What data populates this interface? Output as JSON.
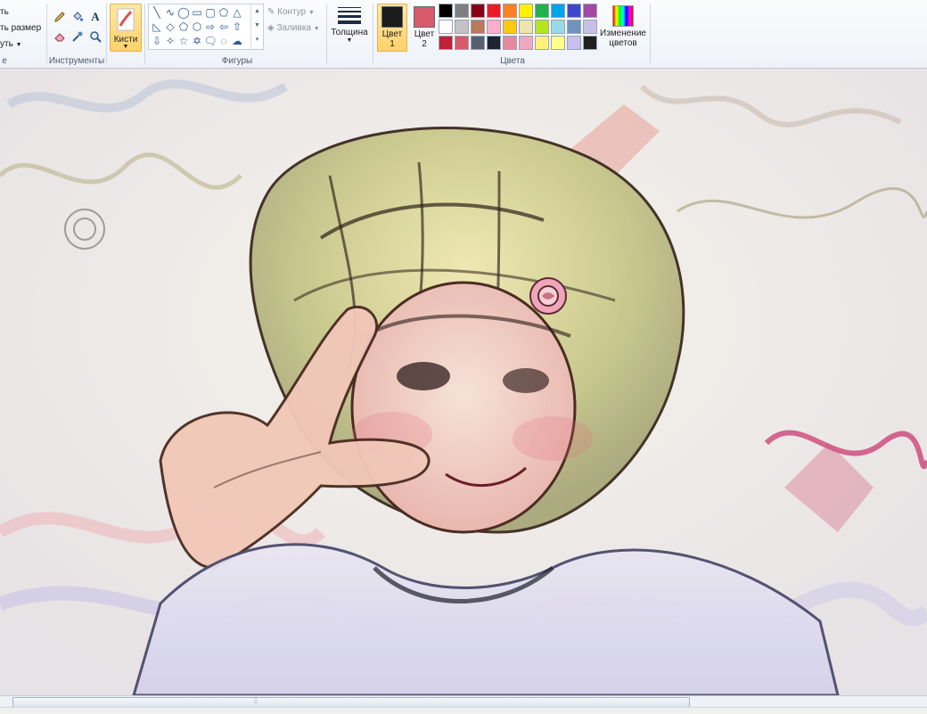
{
  "ribbon": {
    "image_group": {
      "item1": "ть",
      "item2": "ть размер",
      "item3": "уть",
      "label": "е"
    },
    "tools_group": {
      "label": "Инструменты",
      "text_tool": "A"
    },
    "brushes": {
      "label": "Кисти"
    },
    "shapes_group": {
      "label": "Фигуры",
      "outline": "Контур",
      "fill": "Заливка"
    },
    "thickness": {
      "label": "Толщина"
    },
    "color1": {
      "line1": "Цвет",
      "line2": "1",
      "color": "#1b1b1b"
    },
    "color2": {
      "line1": "Цвет",
      "line2": "2",
      "color": "#d85a6a"
    },
    "colors_group": {
      "label": "Цвета"
    },
    "edit_colors": {
      "line1": "Изменение",
      "line2": "цветов"
    },
    "palette": {
      "row1": [
        "#000000",
        "#7f7f7f",
        "#880015",
        "#ed1c24",
        "#ff7f27",
        "#fff200",
        "#22b14c",
        "#00a2e8",
        "#3f48cc",
        "#a349a4"
      ],
      "row2": [
        "#ffffff",
        "#c3c3c3",
        "#b97a57",
        "#ffaec9",
        "#ffc90e",
        "#efe4b0",
        "#b5e61d",
        "#99d9ea",
        "#7092be",
        "#c8bfe7"
      ],
      "row3": [
        "#c0203a",
        "#d85a6a",
        "#5a5f70",
        "#1f2330",
        "#e48aa0",
        "#f2a7c0",
        "#fff27a",
        "#ffff8a",
        "#c8c0ee",
        "#202020"
      ]
    }
  },
  "scrollbar": {
    "grip": "⦙⦙"
  }
}
